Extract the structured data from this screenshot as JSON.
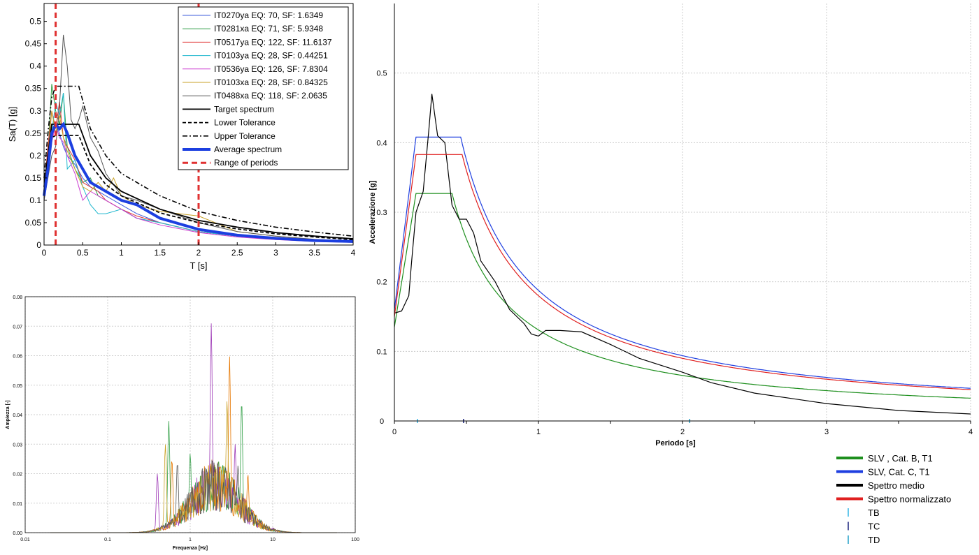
{
  "chart_data": [
    {
      "type": "line",
      "title": "",
      "xlabel": "T [s]",
      "ylabel": "Sa(T) [g]",
      "xlim": [
        0,
        4
      ],
      "ylim": [
        0,
        0.54
      ],
      "xticks": [
        "0",
        "0.5",
        "1",
        "1.5",
        "2",
        "2.5",
        "3",
        "3.5",
        "4"
      ],
      "yticks": [
        "0",
        "0.05",
        "0.1",
        "0.15",
        "0.2",
        "0.25",
        "0.3",
        "0.35",
        "0.4",
        "0.45",
        "0.5"
      ],
      "grid": false,
      "legend_position": "top-right",
      "series": [
        {
          "name": "IT0270ya EQ: 70, SF: 1.6349",
          "color": "#3b5bdb",
          "style": "thin",
          "x": [
            0,
            0.05,
            0.1,
            0.15,
            0.2,
            0.25,
            0.3,
            0.4,
            0.5,
            0.6,
            0.7,
            0.8,
            1.0,
            1.2,
            1.5,
            2.0,
            2.5,
            3.0,
            3.5,
            4.0
          ],
          "y": [
            0.11,
            0.15,
            0.24,
            0.27,
            0.25,
            0.22,
            0.2,
            0.18,
            0.15,
            0.13,
            0.12,
            0.11,
            0.09,
            0.07,
            0.05,
            0.03,
            0.02,
            0.015,
            0.01,
            0.008
          ]
        },
        {
          "name": "IT0281xa EQ: 71, SF: 5.9348",
          "color": "#2f9e44",
          "style": "thin",
          "x": [
            0,
            0.05,
            0.1,
            0.15,
            0.2,
            0.25,
            0.3,
            0.4,
            0.5,
            0.6,
            0.7,
            0.8,
            1.0,
            1.2,
            1.5,
            2.0,
            2.5,
            3.0,
            3.5,
            4.0
          ],
          "y": [
            0.1,
            0.2,
            0.36,
            0.3,
            0.27,
            0.34,
            0.22,
            0.17,
            0.14,
            0.15,
            0.11,
            0.1,
            0.08,
            0.06,
            0.05,
            0.03,
            0.02,
            0.014,
            0.01,
            0.007
          ]
        },
        {
          "name": "IT0517ya EQ: 122, SF: 11.6137",
          "color": "#e03131",
          "style": "thin",
          "x": [
            0,
            0.05,
            0.1,
            0.15,
            0.2,
            0.25,
            0.3,
            0.4,
            0.5,
            0.6,
            0.7,
            0.8,
            1.0,
            1.2,
            1.5,
            2.0,
            2.5,
            3.0,
            3.5,
            4.0
          ],
          "y": [
            0.12,
            0.22,
            0.3,
            0.26,
            0.32,
            0.24,
            0.22,
            0.19,
            0.14,
            0.13,
            0.12,
            0.1,
            0.08,
            0.065,
            0.05,
            0.03,
            0.02,
            0.014,
            0.01,
            0.007
          ]
        },
        {
          "name": "IT0103ya EQ: 28, SF: 0.44251",
          "color": "#22b8cf",
          "style": "thin",
          "x": [
            0,
            0.05,
            0.1,
            0.15,
            0.2,
            0.25,
            0.3,
            0.4,
            0.5,
            0.6,
            0.7,
            0.8,
            1.0,
            1.2,
            1.5,
            2.0,
            2.5,
            3.0,
            3.5,
            4.0
          ],
          "y": [
            0.11,
            0.17,
            0.25,
            0.32,
            0.29,
            0.34,
            0.17,
            0.19,
            0.13,
            0.09,
            0.07,
            0.07,
            0.08,
            0.06,
            0.05,
            0.03,
            0.02,
            0.012,
            0.009,
            0.006
          ]
        },
        {
          "name": "IT0536ya EQ: 126, SF: 7.8304",
          "color": "#cc3bd1",
          "style": "thin",
          "x": [
            0,
            0.05,
            0.1,
            0.15,
            0.2,
            0.25,
            0.3,
            0.4,
            0.5,
            0.6,
            0.7,
            0.8,
            1.0,
            1.2,
            1.5,
            2.0,
            2.5,
            3.0,
            3.5,
            4.0
          ],
          "y": [
            0.1,
            0.16,
            0.23,
            0.27,
            0.24,
            0.23,
            0.2,
            0.16,
            0.1,
            0.12,
            0.11,
            0.1,
            0.08,
            0.06,
            0.045,
            0.028,
            0.018,
            0.012,
            0.008,
            0.006
          ]
        },
        {
          "name": "IT0103xa EQ: 28, SF: 0.84325",
          "color": "#c9a227",
          "style": "thin",
          "x": [
            0,
            0.05,
            0.1,
            0.15,
            0.2,
            0.25,
            0.3,
            0.4,
            0.5,
            0.6,
            0.7,
            0.8,
            0.9,
            1.0,
            1.2,
            1.5,
            2.0,
            2.5,
            3.0,
            3.5,
            4.0
          ],
          "y": [
            0.12,
            0.2,
            0.3,
            0.25,
            0.29,
            0.24,
            0.21,
            0.17,
            0.13,
            0.12,
            0.14,
            0.12,
            0.15,
            0.11,
            0.09,
            0.075,
            0.065,
            0.03,
            0.02,
            0.012,
            0.008
          ]
        },
        {
          "name": "IT0488xa EQ: 118, SF: 2.0635",
          "color": "#555555",
          "style": "thin",
          "x": [
            0,
            0.05,
            0.1,
            0.15,
            0.2,
            0.25,
            0.3,
            0.35,
            0.4,
            0.45,
            0.5,
            0.6,
            0.7,
            0.8,
            1.0,
            1.2,
            1.5,
            2.0,
            2.5,
            3.0,
            3.5,
            4.0
          ],
          "y": [
            0.1,
            0.15,
            0.2,
            0.22,
            0.31,
            0.47,
            0.4,
            0.28,
            0.26,
            0.28,
            0.31,
            0.24,
            0.21,
            0.16,
            0.11,
            0.1,
            0.08,
            0.05,
            0.03,
            0.02,
            0.013,
            0.009
          ]
        },
        {
          "name": "Target spectrum",
          "color": "#000000",
          "style": "solid",
          "x": [
            0,
            0.05,
            0.1,
            0.15,
            0.3,
            0.45,
            0.6,
            0.8,
            1.0,
            1.5,
            2.0,
            2.5,
            3.0,
            3.5,
            4.0
          ],
          "y": [
            0.13,
            0.2,
            0.27,
            0.27,
            0.27,
            0.27,
            0.2,
            0.15,
            0.12,
            0.08,
            0.055,
            0.04,
            0.028,
            0.02,
            0.014
          ]
        },
        {
          "name": "Lower Tolerance",
          "color": "#000000",
          "style": "dashed",
          "x": [
            0,
            0.05,
            0.1,
            0.15,
            0.3,
            0.45,
            0.6,
            0.8,
            1.0,
            1.5,
            2.0,
            2.5,
            3.0,
            3.5,
            4.0
          ],
          "y": [
            0.12,
            0.18,
            0.24,
            0.245,
            0.245,
            0.245,
            0.18,
            0.135,
            0.11,
            0.072,
            0.05,
            0.036,
            0.025,
            0.018,
            0.012
          ]
        },
        {
          "name": "Upper Tolerance",
          "color": "#000000",
          "style": "dashdot",
          "x": [
            0,
            0.05,
            0.1,
            0.15,
            0.3,
            0.45,
            0.6,
            0.8,
            1.0,
            1.5,
            2.0,
            2.5,
            3.0,
            3.5,
            4.0
          ],
          "y": [
            0.15,
            0.25,
            0.33,
            0.355,
            0.355,
            0.355,
            0.26,
            0.2,
            0.16,
            0.11,
            0.075,
            0.055,
            0.04,
            0.029,
            0.02
          ]
        },
        {
          "name": "Average spectrum",
          "color": "#1c3fe0",
          "style": "thick",
          "x": [
            0,
            0.05,
            0.1,
            0.15,
            0.2,
            0.25,
            0.3,
            0.4,
            0.5,
            0.6,
            0.7,
            0.8,
            1.0,
            1.2,
            1.5,
            2.0,
            2.5,
            3.0,
            3.5,
            4.0
          ],
          "y": [
            0.11,
            0.17,
            0.25,
            0.27,
            0.26,
            0.27,
            0.25,
            0.2,
            0.17,
            0.14,
            0.13,
            0.12,
            0.1,
            0.09,
            0.06,
            0.035,
            0.022,
            0.015,
            0.01,
            0.008
          ]
        },
        {
          "name": "Range of periods",
          "color": "#e03131",
          "style": "vline",
          "x": [
            0.15,
            2.0
          ]
        }
      ]
    },
    {
      "type": "line",
      "title": "",
      "xlabel": "Frequenza [Hz]",
      "ylabel": "Ampiezza [-]",
      "xscale": "log",
      "xlim": [
        0.01,
        100
      ],
      "ylim": [
        0,
        0.08
      ],
      "xticks": [
        "0.01",
        "0.1",
        "1",
        "10",
        "100"
      ],
      "yticks": [
        "0.00",
        "0.01",
        "0.02",
        "0.03",
        "0.04",
        "0.05",
        "0.06",
        "0.07",
        "0.08"
      ],
      "grid": true,
      "series": [
        {
          "color": "#2f9e44",
          "peaks": [
            [
              0.55,
              0.038
            ],
            [
              1.0,
              0.027
            ],
            [
              4.2,
              0.045
            ],
            [
              2.2,
              0.025
            ]
          ]
        },
        {
          "color": "#9c36b5",
          "peaks": [
            [
              1.8,
              0.071
            ],
            [
              0.4,
              0.02
            ],
            [
              3.5,
              0.03
            ]
          ]
        },
        {
          "color": "#e67700",
          "peaks": [
            [
              3.0,
              0.06
            ],
            [
              0.6,
              0.025
            ],
            [
              5.0,
              0.02
            ]
          ]
        },
        {
          "color": "#c9a227",
          "peaks": [
            [
              2.8,
              0.045
            ],
            [
              0.5,
              0.03
            ],
            [
              1.6,
              0.02
            ]
          ]
        },
        {
          "color": "#555555",
          "peaks": [
            [
              0.7,
              0.024
            ],
            [
              2.0,
              0.022
            ],
            [
              3.8,
              0.023
            ]
          ]
        }
      ]
    },
    {
      "type": "line",
      "title": "",
      "xlabel": "Periodo [s]",
      "ylabel": "Accelerazione [g]",
      "xlim": [
        0,
        4
      ],
      "ylim": [
        0,
        0.6
      ],
      "xticks": [
        "0",
        "1",
        "2",
        "3",
        "4"
      ],
      "yticks": [
        "0",
        "0.1",
        "0.2",
        "0.3",
        "0.4",
        "0.5"
      ],
      "grid": true,
      "legend_position": "bottom-right",
      "series": [
        {
          "name": "SLV , Cat. B, T1",
          "color": "#1e8f1e",
          "ag": 0.135,
          "plateau": 0.327,
          "TB": 0.15,
          "TC": 0.4
        },
        {
          "name": "SLV, Cat. C, T1",
          "color": "#1f3fe0",
          "ag": 0.16,
          "plateau": 0.408,
          "TB": 0.15,
          "TC": 0.46
        },
        {
          "name": "Spettro medio",
          "color": "#000000",
          "x": [
            0,
            0.05,
            0.1,
            0.12,
            0.15,
            0.2,
            0.24,
            0.26,
            0.3,
            0.35,
            0.4,
            0.45,
            0.5,
            0.55,
            0.6,
            0.7,
            0.8,
            0.9,
            0.95,
            1.0,
            1.05,
            1.15,
            1.3,
            1.5,
            1.7,
            2.0,
            2.2,
            2.5,
            3.0,
            3.5,
            4.0
          ],
          "y": [
            0.155,
            0.158,
            0.18,
            0.23,
            0.3,
            0.33,
            0.42,
            0.47,
            0.41,
            0.4,
            0.31,
            0.29,
            0.29,
            0.27,
            0.23,
            0.2,
            0.16,
            0.14,
            0.125,
            0.122,
            0.13,
            0.13,
            0.128,
            0.11,
            0.09,
            0.07,
            0.055,
            0.04,
            0.025,
            0.015,
            0.01
          ]
        },
        {
          "name": "Spettro normalizzato",
          "color": "#e02020",
          "ag": 0.15,
          "plateau": 0.383,
          "TB": 0.15,
          "TC": 0.47
        },
        {
          "name": "TB",
          "color": "#33b5e5",
          "marker": "tick",
          "x": 0.16
        },
        {
          "name": "TC",
          "color": "#1a237e",
          "marker": "tick",
          "x": 0.48
        },
        {
          "name": "TD",
          "color": "#22a0c8",
          "marker": "tick",
          "x": 2.05
        }
      ]
    }
  ]
}
